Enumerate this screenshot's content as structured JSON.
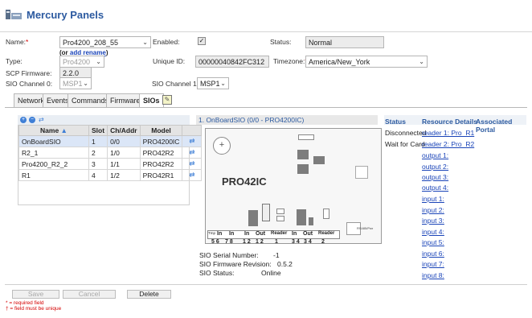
{
  "app": {
    "title": "Mercury Panels"
  },
  "form": {
    "name_label": "Name:",
    "name_value": "Pro4200_208_55",
    "add_prefix": "(or ",
    "add_link": "add",
    "rename_link": "rename",
    "add_suffix": ")",
    "enabled_label": "Enabled:",
    "enabled_checked": true,
    "status_label": "Status:",
    "status_value": "Normal",
    "type_label": "Type:",
    "type_value": "Pro4200",
    "unique_id_label": "Unique ID:",
    "unique_id_value": "00000040842FC312",
    "timezone_label": "Timezone:",
    "timezone_value": "America/New_York",
    "scp_firmware_label": "SCP Firmware:",
    "scp_firmware_value": "2.2.0",
    "sio_channel0_label": "SIO Channel 0:",
    "sio_channel0_value": "MSP1",
    "sio_channel1_label": "SIO Channel 1:",
    "sio_channel1_value": "MSP1"
  },
  "tabs": [
    {
      "label": "Network"
    },
    {
      "label": "Events"
    },
    {
      "label": "Commands"
    },
    {
      "label": "Firmware"
    },
    {
      "label": "SIOs",
      "active": true
    }
  ],
  "sio_table": {
    "columns": [
      "Name",
      "Slot",
      "Ch/Addr",
      "Model"
    ],
    "rows": [
      {
        "name": "OnBoardSIO",
        "slot": "1",
        "ch": "0/0",
        "model": "PRO4200IC"
      },
      {
        "name": "R2_1",
        "slot": "2",
        "ch": "1/0",
        "model": "PRO42R2"
      },
      {
        "name": "Pro4200_R2_2",
        "slot": "3",
        "ch": "1/1",
        "model": "PRO42R2"
      },
      {
        "name": "R1",
        "slot": "4",
        "ch": "1/2",
        "model": "PRO42R1"
      }
    ]
  },
  "diagram": {
    "header": "1. OnBoardSIO (0/0 - PRO4200IC)",
    "board_label": "PRO42IC",
    "tamper_label": "Tmp",
    "terminal_labels": [
      "In",
      "In",
      "In",
      "Out",
      "Reader",
      "In",
      "Out",
      "Reader"
    ],
    "terminal_numbers": [
      "5 6",
      "7 8",
      "1 2",
      "1 2",
      "1",
      "3 4",
      "3 4",
      "2"
    ],
    "aux_label": "RS485/Pwr",
    "serial_label": "SIO Serial Number:",
    "serial_value": "-1",
    "firmware_label": "SIO Firmware Revision:",
    "firmware_value": "0.5.2",
    "status_label": "SIO Status:",
    "status_value": "Online"
  },
  "status_columns": {
    "status_header": "Status",
    "resource_header": "Resource Details",
    "portal_header": "Associated Portal",
    "statuses": [
      "Disconnected",
      "Wait for Card"
    ],
    "resources": [
      "reader 1: Pro_R1",
      "reader 2: Pro_R2",
      "output 1:",
      "output 2:",
      "output 3:",
      "output 4:",
      "input 1:",
      "input 2:",
      "input 3:",
      "input 4:",
      "input 5:",
      "input 6:",
      "input 7:",
      "input 8:"
    ]
  },
  "footer": {
    "save_label": "Save",
    "cancel_label": "Cancel",
    "delete_label": "Delete",
    "note_required": "* = required field",
    "note_unique": "† = field must be unique"
  },
  "colors": {
    "accent": "#2c5aa0",
    "link": "#1a44b8",
    "required": "#d40000"
  }
}
